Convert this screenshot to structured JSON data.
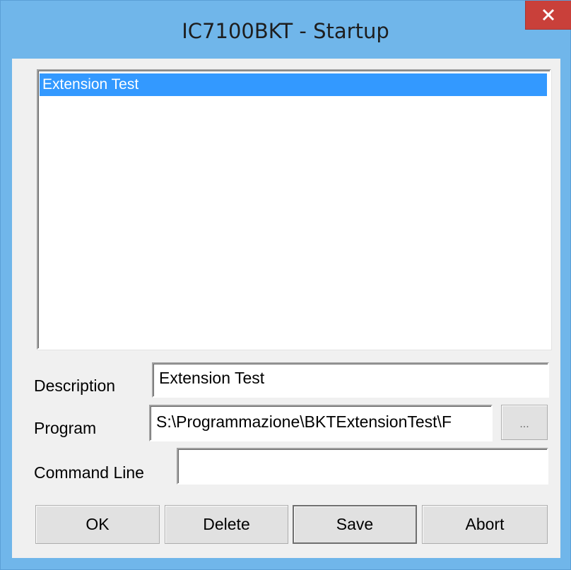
{
  "window": {
    "title": "IC7100BKT - Startup",
    "accent": "#70b6ea",
    "close_color": "#c9403a"
  },
  "list": {
    "items": [
      {
        "label": "Extension Test",
        "selected": true
      }
    ],
    "selection_color": "#3399ff"
  },
  "form": {
    "description_label": "Description",
    "description_value": "Extension Test",
    "program_label": "Program",
    "program_value": "S:\\Programmazione\\BKTExtensionTest\\F",
    "browse_label": "...",
    "command_line_label": "Command Line",
    "command_line_value": ""
  },
  "buttons": {
    "ok": "OK",
    "delete": "Delete",
    "save": "Save",
    "abort": "Abort"
  }
}
